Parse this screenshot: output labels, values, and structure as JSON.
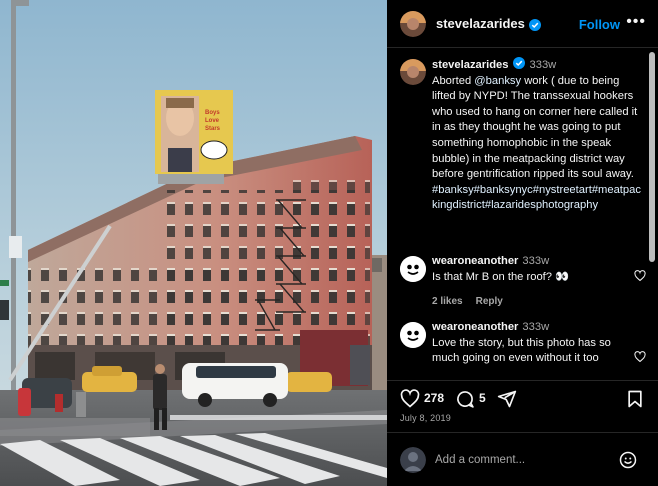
{
  "post": {
    "photo": {
      "billboard_text": "Boys Love Stars"
    },
    "author": {
      "username": "stevelazarides",
      "verified": true
    },
    "follow_label": "Follow",
    "more_icon": "more-horizontal-icon",
    "caption": {
      "username": "stevelazarides",
      "age": "333w",
      "text_before": "Aborted ",
      "mention": "@banksy",
      "text_after": " work ( due to being lifted by NYPD! The transsexual hookers who used to hang on corner here called it in as they thought he was going to put something homophobic in the speak bubble) in the meatpacking district way before gentrification ripped its soul away.",
      "hashtags": "#banksy#banksynyc#nystreetart#meatpackingdistrict#lazaridesphotography"
    },
    "comments": [
      {
        "username": "wearoneanother",
        "age": "333w",
        "text": "Is that Mr B on the roof? 👀",
        "likes": "2 likes",
        "reply_label": "Reply"
      },
      {
        "username": "wearoneanother",
        "age": "333w",
        "text": "Love the story, but this photo has so much going on even without it too"
      }
    ],
    "actions": {
      "like_count": "278",
      "comment_count": "5",
      "icons": [
        "heart-icon",
        "comment-icon",
        "share-icon",
        "bookmark-icon"
      ]
    },
    "date": "July 8, 2019",
    "add_comment": {
      "placeholder": "Add a comment...",
      "emoji_icon": "smile-icon"
    },
    "colors": {
      "accent": "#0095f6",
      "background": "#000000",
      "muted": "#a8a8a8"
    }
  }
}
